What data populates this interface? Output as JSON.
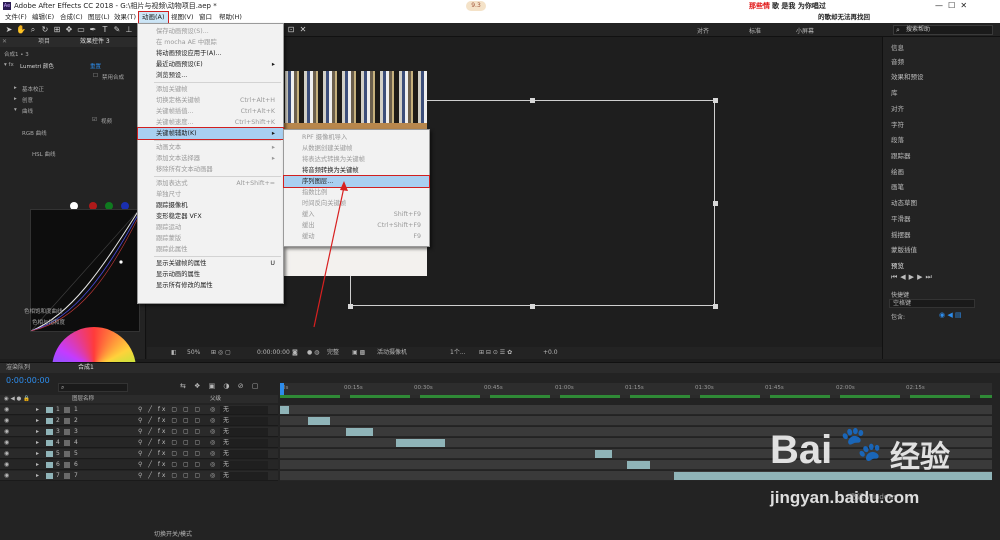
{
  "window": {
    "title": "Adobe After Effects CC 2018 - G:\\相片与视频\\动物项目.aep *",
    "overlay_red": "那些情",
    "overlay_black1": "歌 是我 为你唱过",
    "overlay_black2": "的歌却无法再找回",
    "badge": "9.3"
  },
  "menubar": [
    "文件(F)",
    "编辑(E)",
    "合成(C)",
    "图层(L)",
    "效果(T)",
    "动画(A)",
    "视图(V)",
    "窗口",
    "帮助(H)"
  ],
  "toolbar": {
    "tabs": [
      "对齐",
      "标准",
      "小屏幕"
    ],
    "search_placeholder": "搜索帮助"
  },
  "left_panel": {
    "tabs": [
      "项目",
      "效果控件 3"
    ],
    "subheader": "合成1 • 3",
    "effect_name": "Lumetri 颜色",
    "reset": "重置",
    "checkbox_label": "禁用合成",
    "sections": [
      "基本校正",
      "创意",
      "曲线"
    ],
    "rgb_curves": "RGB 曲线",
    "hsl": "HSL 曲线",
    "hue_sat": "色相饱和度曲线",
    "hue_sub": "色相与饱和度",
    "video_label": "视频"
  },
  "animation_menu": [
    {
      "label": "保存动画预设(S)...",
      "shortcut": "",
      "disabled": true
    },
    {
      "label": "在 mocha AE 中跟踪",
      "shortcut": "",
      "disabled": true
    },
    {
      "label": "将动画预设应用于(A)...",
      "shortcut": "",
      "disabled": false
    },
    {
      "label": "最近动画预设(E)",
      "shortcut": "▸",
      "disabled": false
    },
    {
      "label": "浏览预设...",
      "shortcut": "",
      "disabled": false
    },
    {
      "label": "添加关键帧",
      "shortcut": "",
      "disabled": true
    },
    {
      "label": "切换定格关键帧",
      "shortcut": "Ctrl+Alt+H",
      "disabled": true
    },
    {
      "label": "关键帧插值...",
      "shortcut": "Ctrl+Alt+K",
      "disabled": true
    },
    {
      "label": "关键帧速度...",
      "shortcut": "Ctrl+Shift+K",
      "disabled": true
    },
    {
      "label": "关键帧辅助(K)",
      "shortcut": "▸",
      "disabled": false,
      "highlighted": true
    },
    {
      "label": "动画文本",
      "shortcut": "▸",
      "disabled": true
    },
    {
      "label": "添加文本选择器",
      "shortcut": "▸",
      "disabled": true
    },
    {
      "label": "移除所有文本动画器",
      "shortcut": "",
      "disabled": true
    },
    {
      "label": "添加表达式",
      "shortcut": "Alt+Shift+=",
      "disabled": true
    },
    {
      "label": "单独尺寸",
      "shortcut": "",
      "disabled": true
    },
    {
      "label": "跟踪摄像机",
      "shortcut": "",
      "disabled": false
    },
    {
      "label": "变形稳定器 VFX",
      "shortcut": "",
      "disabled": false
    },
    {
      "label": "跟踪运动",
      "shortcut": "",
      "disabled": true
    },
    {
      "label": "跟踪蒙版",
      "shortcut": "",
      "disabled": true
    },
    {
      "label": "跟踪此属性",
      "shortcut": "",
      "disabled": true
    },
    {
      "label": "显示关键帧的属性",
      "shortcut": "U",
      "disabled": false
    },
    {
      "label": "显示动画的属性",
      "shortcut": "",
      "disabled": false
    },
    {
      "label": "显示所有修改的属性",
      "shortcut": "",
      "disabled": false
    }
  ],
  "keyframe_submenu": [
    {
      "label": "RPF 摄像机导入",
      "shortcut": "",
      "disabled": true
    },
    {
      "label": "从数据创建关键帧",
      "shortcut": "",
      "disabled": true
    },
    {
      "label": "将表达式转换为关键帧",
      "shortcut": "",
      "disabled": true
    },
    {
      "label": "将音频转换为关键帧",
      "shortcut": "",
      "disabled": false
    },
    {
      "label": "序列图层...",
      "shortcut": "",
      "disabled": false,
      "highlighted": true
    },
    {
      "label": "指数比例",
      "shortcut": "",
      "disabled": true
    },
    {
      "label": "时间反向关键帧",
      "shortcut": "",
      "disabled": true
    },
    {
      "label": "缓入",
      "shortcut": "Shift+F9",
      "disabled": true
    },
    {
      "label": "缓出",
      "shortcut": "Ctrl+Shift+F9",
      "disabled": true
    },
    {
      "label": "缓动",
      "shortcut": "F9",
      "disabled": true
    }
  ],
  "view_footer": {
    "zoom": "50%",
    "time": "0:00:00:00",
    "quality": "完整",
    "camera": "活动摄像机",
    "views": "1个...",
    "exposure": "+0.0"
  },
  "right_panel": {
    "items": [
      "信息",
      "音频",
      "效果和预设",
      "库",
      "对齐",
      "字符",
      "段落",
      "跟踪器",
      "绘画",
      "画笔",
      "动态草图",
      "平滑器",
      "摇摆器",
      "蒙版插值"
    ],
    "preview_title": "预览",
    "shortcut_label": "快捷键",
    "shortcut_value": "空格键",
    "include_label": "包含:"
  },
  "timeline": {
    "tabs": [
      "渲染队列",
      "合成1"
    ],
    "timecode": "0:00:00:00",
    "col_layer_name": "图层名称",
    "col_parent": "父级",
    "ruler": [
      "0s",
      "00:15s",
      "00:30s",
      "00:45s",
      "01:00s",
      "01:15s",
      "01:30s",
      "01:45s",
      "02:00s",
      "02:15s"
    ],
    "layers": [
      {
        "num": "1",
        "name": "1",
        "parent": "无",
        "clip_start": 0.0,
        "clip_end": 0.012
      },
      {
        "num": "2",
        "name": "2",
        "parent": "无",
        "clip_start": 0.04,
        "clip_end": 0.07
      },
      {
        "num": "3",
        "name": "3",
        "parent": "无",
        "clip_start": 0.092,
        "clip_end": 0.13
      },
      {
        "num": "4",
        "name": "4",
        "parent": "无",
        "clip_start": 0.163,
        "clip_end": 0.232
      },
      {
        "num": "5",
        "name": "5",
        "parent": "无",
        "clip_start": 0.442,
        "clip_end": 0.466
      },
      {
        "num": "6",
        "name": "6",
        "parent": "无",
        "clip_start": 0.487,
        "clip_end": 0.52
      },
      {
        "num": "7",
        "name": "7",
        "parent": "无",
        "clip_start": 0.553,
        "clip_end": 1.0
      }
    ],
    "footer": "切换开关/模式"
  },
  "watermark": {
    "brand": "Bai",
    "brand2": "经验",
    "url": "jingyan.baidu.com",
    "win1": "激活 Windows",
    "win2": "转到\"设置\"以激活 Windows。"
  }
}
